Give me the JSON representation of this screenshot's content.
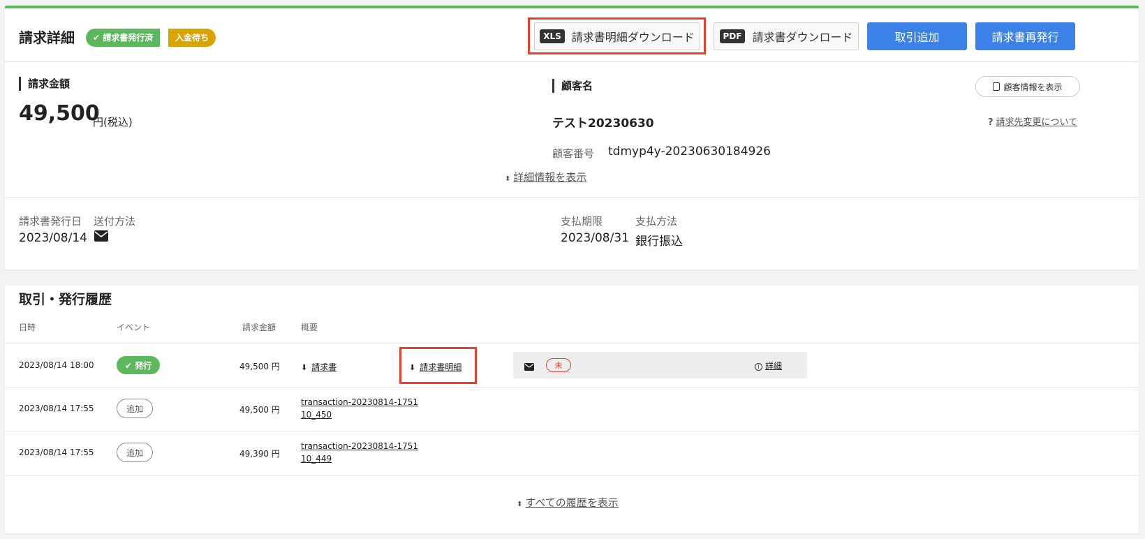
{
  "header": {
    "title": "請求詳細",
    "badge_issued": "✔ 請求書発行済",
    "badge_waiting": "入金待ち",
    "xls_tag": "XLS",
    "xls_label": "請求書明細ダウンロード",
    "pdf_tag": "PDF",
    "pdf_label": "請求書ダウンロード",
    "add_transaction": "取引追加",
    "reissue": "請求書再発行"
  },
  "amount": {
    "label": "請求金額",
    "value": "49,500",
    "unit": "円(税込)"
  },
  "customer": {
    "label": "顧客名",
    "show_info_button": "顧客情報を表示",
    "name": "テスト20230630",
    "change_link": "請求先変更について",
    "number_label": "顧客番号",
    "number": "tdmyp4y-20230630184926",
    "detail_link": "詳細情報を表示"
  },
  "info": {
    "issue_date_label": "請求書発行日",
    "issue_date": "2023/08/14",
    "send_method_label": "送付方法",
    "due_label": "支払期限",
    "due_date": "2023/08/31",
    "payment_method_label": "支払方法",
    "payment_method": "銀行振込"
  },
  "history": {
    "title": "取引・発行履歴",
    "columns": {
      "datetime": "日時",
      "event": "イベント",
      "amount": "請求金額",
      "summary": "概要"
    },
    "rows": [
      {
        "datetime": "2023/08/14 18:00",
        "event": "✔ 発行",
        "amount": "49,500 円",
        "link1": "請求書",
        "link2": "請求書明細",
        "status": "未",
        "detail": "詳細"
      },
      {
        "datetime": "2023/08/14 17:55",
        "event": "追加",
        "amount": "49,500 円",
        "summary_line1": "transaction-20230814-1751",
        "summary_line2": "10_450"
      },
      {
        "datetime": "2023/08/14 17:55",
        "event": "追加",
        "amount": "49,390 円",
        "summary_line1": "transaction-20230814-1751",
        "summary_line2": "10_449"
      }
    ],
    "show_all": "すべての履歴を表示"
  },
  "colors": {
    "accent_green": "#5cb85c",
    "accent_yellow": "#d9a400",
    "button_blue": "#3b82e8",
    "highlight_red": "#e8402a"
  }
}
